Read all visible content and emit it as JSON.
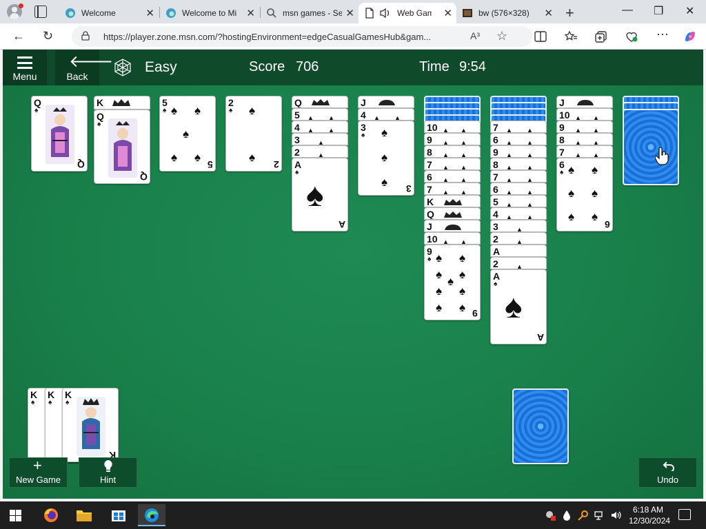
{
  "browser": {
    "tabs": [
      {
        "title": "Welcome",
        "favicon": "edge-swirl-icon"
      },
      {
        "title": "Welcome to Mi",
        "favicon": "edge-swirl-icon"
      },
      {
        "title": "msn games - Se",
        "favicon": "search-icon"
      },
      {
        "title": "Web Game",
        "favicon": "page-icon",
        "active": true,
        "audio": true
      },
      {
        "title": "bw (576×328)",
        "favicon": "image-thumb-icon"
      }
    ],
    "url": "https://player.zone.msn.com/?hostingEnvironment=edgeCasualGamesHub&gam...",
    "readaloud_label": "A³"
  },
  "game": {
    "menu_label": "Menu",
    "back_label": "Back",
    "level": "Easy",
    "score_label": "Score",
    "score": "706",
    "time_label": "Time",
    "time": "9:54",
    "new_game_label": "New Game",
    "hint_label": "Hint",
    "undo_label": "Undo",
    "colors": {
      "felt": "#19804b",
      "topbar": "#0f4a2a",
      "card_back": "#1a6fd6"
    },
    "tableau": [
      {
        "face_down": 0,
        "face_up": [
          "Q"
        ]
      },
      {
        "face_down": 0,
        "face_up": [
          "K",
          "Q"
        ]
      },
      {
        "face_down": 0,
        "face_up": [
          "5"
        ]
      },
      {
        "face_down": 0,
        "face_up": [
          "2"
        ]
      },
      {
        "face_down": 0,
        "face_up": [
          "Q",
          "5",
          "4",
          "3",
          "2",
          "A"
        ]
      },
      {
        "face_down": 0,
        "face_up": [
          "J",
          "4",
          "3"
        ]
      },
      {
        "face_down": 4,
        "face_up": [
          "10",
          "9",
          "8",
          "7",
          "6",
          "7",
          "K",
          "Q",
          "J",
          "10",
          "9"
        ]
      },
      {
        "face_down": 4,
        "face_up": [
          "7",
          "6",
          "9",
          "8",
          "7",
          "6",
          "5",
          "4",
          "3",
          "2",
          "A",
          "2",
          "A"
        ]
      },
      {
        "face_down": 0,
        "face_up": [
          "J",
          "10",
          "9",
          "8",
          "7",
          "6"
        ]
      },
      {
        "face_down": 2,
        "face_up": []
      }
    ],
    "completed_foundations": [
      "K",
      "K",
      "K"
    ],
    "stock_piles": 1
  },
  "taskbar": {
    "time": "6:18 AM",
    "date": "12/30/2024"
  }
}
